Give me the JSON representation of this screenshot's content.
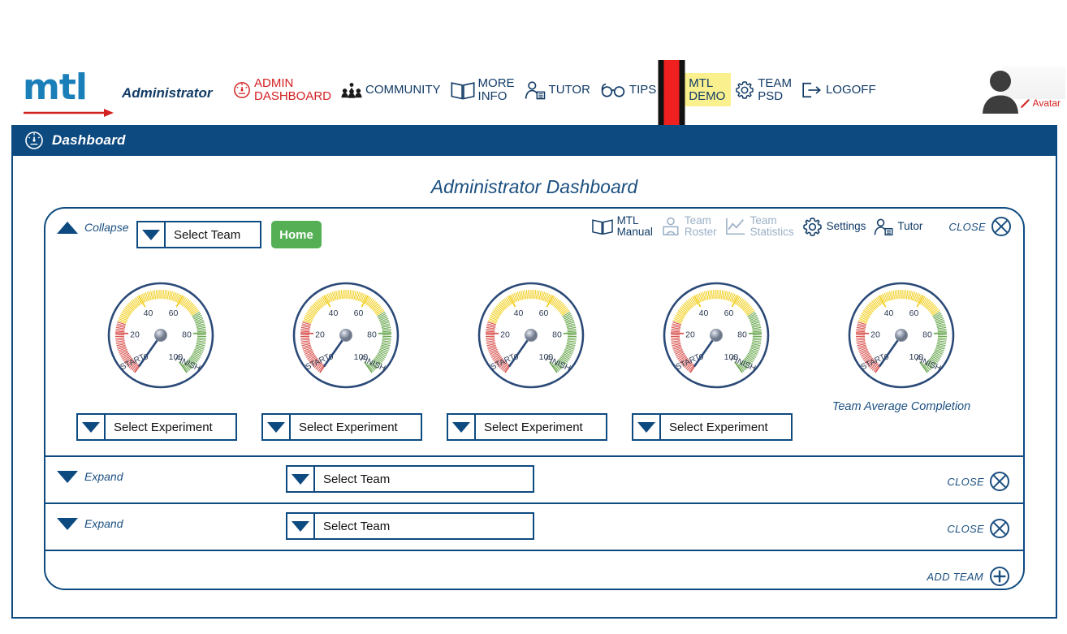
{
  "header": {
    "logo_text": "mtl",
    "role": "Administrator",
    "nav": [
      {
        "label_line1": "ADMIN",
        "label_line2": "DASHBOARD",
        "icon": "gauge-icon",
        "style": "red"
      },
      {
        "label_line1": "COMMUNITY",
        "label_line2": "",
        "icon": "community-icon",
        "style": "normal"
      },
      {
        "label_line1": "MORE",
        "label_line2": "INFO",
        "icon": "book-icon",
        "style": "normal"
      },
      {
        "label_line1": "TUTOR",
        "label_line2": "",
        "icon": "tutor-icon",
        "style": "normal"
      },
      {
        "label_line1": "TIPS",
        "label_line2": "",
        "icon": "glasses-icon",
        "style": "normal"
      },
      {
        "label_line1": "MTL",
        "label_line2": "DEMO",
        "icon": "gear-icon",
        "style": "highlight"
      },
      {
        "label_line1": "TEAM",
        "label_line2": "PSD",
        "icon": "gear-icon",
        "style": "normal"
      },
      {
        "label_line1": "LOGOFF",
        "label_line2": "",
        "icon": "logoff-icon",
        "style": "normal"
      }
    ],
    "avatar_label": "Avatar"
  },
  "titlebar": {
    "text": "Dashboard",
    "icon": "gauge-icon"
  },
  "main": {
    "page_title": "Administrator Dashboard"
  },
  "team_card": {
    "collapse_label": "Collapse",
    "team_select_value": "Select Team",
    "home_label": "Home",
    "tools": [
      {
        "label_line1": "MTL",
        "label_line2": "Manual",
        "icon": "book-icon",
        "dim": false
      },
      {
        "label_line1": "Team",
        "label_line2": "Roster",
        "icon": "roster-icon",
        "dim": true
      },
      {
        "label_line1": "Team",
        "label_line2": "Statistics",
        "icon": "statistics-icon",
        "dim": true
      },
      {
        "label_line1": "Settings",
        "label_line2": "",
        "icon": "gear-icon",
        "dim": false
      },
      {
        "label_line1": "Tutor",
        "label_line2": "",
        "icon": "tutor-icon",
        "dim": false
      }
    ],
    "close_label": "CLOSE",
    "team_average_label": "Team Average Completion",
    "gauges": [
      {
        "value": 0,
        "label_start": "START",
        "label_finish": "FINISH"
      },
      {
        "value": 0,
        "label_start": "START",
        "label_finish": "FINISH"
      },
      {
        "value": 0,
        "label_start": "START",
        "label_finish": "FINISH"
      },
      {
        "value": 0,
        "label_start": "START",
        "label_finish": "FINISH"
      },
      {
        "value": 0,
        "label_start": "START",
        "label_finish": "FINISH"
      }
    ],
    "gauge_ticks": [
      "20",
      "40",
      "60",
      "80",
      "100"
    ],
    "experiment_selects": [
      {
        "value": "Select Experiment"
      },
      {
        "value": "Select Experiment"
      },
      {
        "value": "Select Experiment"
      },
      {
        "value": "Select Experiment"
      }
    ],
    "collapsed_rows": [
      {
        "expand_label": "Expand",
        "team_select_value": "Select Team",
        "close_label": "CLOSE"
      },
      {
        "expand_label": "Expand",
        "team_select_value": "Select Team",
        "close_label": "CLOSE"
      }
    ],
    "add_team_label": "ADD TEAM"
  },
  "colors": {
    "brand_blue": "#0d4a80",
    "logo_blue": "#1a7fb8",
    "accent_red": "#d32020",
    "home_green": "#55b055",
    "highlight_yellow": "#faf08d",
    "gauge_red": "#d9534f",
    "gauge_yellow": "#f2d024",
    "gauge_green": "#6aa84f",
    "dim_gray": "#9bb0c6"
  },
  "annotation": {
    "type": "red-down-arrow",
    "points_to": "MTL DEMO"
  }
}
